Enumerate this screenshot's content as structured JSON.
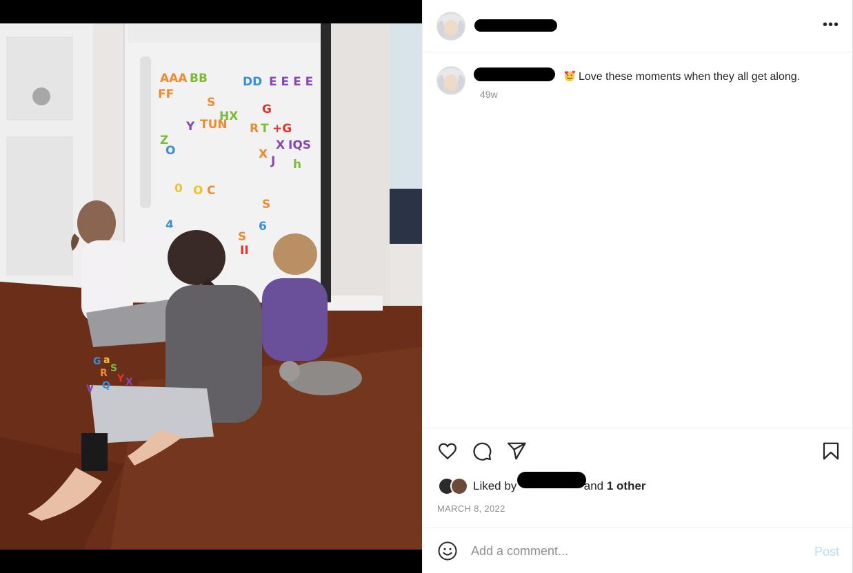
{
  "post": {
    "username": "",
    "caption_text": "Love these moments when they all get along.",
    "time_ago": "49w",
    "liked_prefix": "Liked by ",
    "liked_user": "",
    "liked_and": " and ",
    "liked_others": "1 other",
    "date": "MARCH 8, 2022"
  },
  "comment": {
    "placeholder": "Add a comment...",
    "post_label": "Post"
  },
  "icons": {
    "more": "more-options-icon",
    "like": "heart-icon",
    "comment": "comment-icon",
    "share": "paper-plane-icon",
    "save": "bookmark-icon",
    "emoji": "smiley-icon"
  },
  "colors": {
    "text": "#262626",
    "muted": "#8e8e8e",
    "post_button_disabled": "#b2dffc"
  }
}
